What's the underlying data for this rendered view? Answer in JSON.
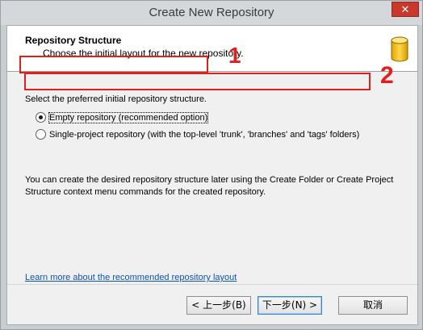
{
  "window": {
    "title": "Create New Repository",
    "close_glyph": "✕"
  },
  "header": {
    "title": "Repository Structure",
    "subtitle": "Choose the initial layout for the new repository.",
    "icon": "database-icon"
  },
  "content": {
    "prompt": "Select the preferred initial repository structure.",
    "options": [
      {
        "label": "Empty repository (recommended option)",
        "checked": true
      },
      {
        "label": "Single-project repository (with the top-level 'trunk', 'branches' and 'tags' folders)",
        "checked": false
      }
    ],
    "description": "You can create the desired repository structure later using the Create Folder or Create Project Structure context menu commands for the created repository.",
    "link": "Learn more about the recommended repository layout"
  },
  "annotations": {
    "one": "1",
    "two": "2",
    "color": "#e0201f"
  },
  "buttons": {
    "back": "< 上一步(B)",
    "next": "下一步(N) >",
    "cancel": "取消"
  }
}
